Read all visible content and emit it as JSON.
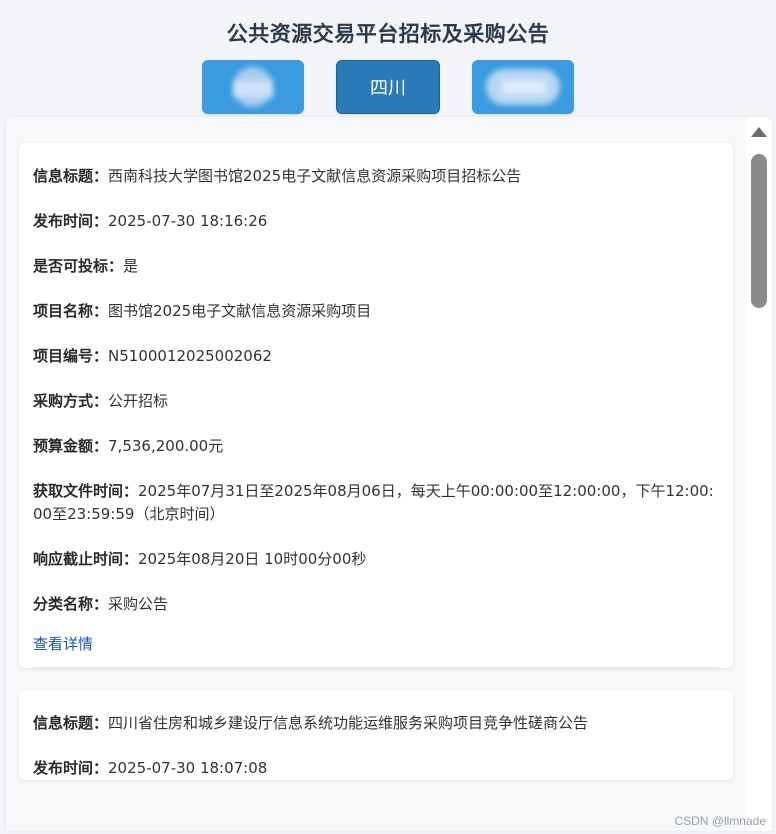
{
  "header": {
    "title": "公共资源交易平台招标及采购公告"
  },
  "tabs": [
    {
      "label": "",
      "state": "blurred"
    },
    {
      "label": "四川",
      "state": "active"
    },
    {
      "label": "",
      "state": "blurred"
    }
  ],
  "labels": {
    "title": "信息标题：",
    "time": "发布时间：",
    "can_bid": "是否可投标：",
    "project_name": "项目名称：",
    "project_no": "项目编号：",
    "method": "采购方式：",
    "budget": "预算金额：",
    "doc_time": "获取文件时间：",
    "deadline": "响应截止时间：",
    "category": "分类名称："
  },
  "notices": [
    {
      "title": "西南科技大学图书馆2025电子文献信息资源采购项目招标公告",
      "time": "2025-07-30 18:16:26",
      "can_bid": "是",
      "project_name": "图书馆2025电子文献信息资源采购项目",
      "project_no": "N5100012025002062",
      "method": "公开招标",
      "budget": "7,536,200.00元",
      "doc_time": "2025年07月31日至2025年08月06日，每天上午00:00:00至12:00:00，下午12:00:00至23:59:59（北京时间）",
      "deadline": "2025年08月20日 10时00分00秒",
      "category": "采购公告",
      "link": "查看详情"
    },
    {
      "title": "四川省住房和城乡建设厅信息系统功能运维服务采购项目竞争性磋商公告",
      "time": "2025-07-30 18:07:08"
    }
  ],
  "watermark": "CSDN @llmnade",
  "colors": {
    "tab": "#3a9be0",
    "tab_active": "#2a7ab8",
    "link": "#1a56b0",
    "title": "#2c3a4a"
  }
}
